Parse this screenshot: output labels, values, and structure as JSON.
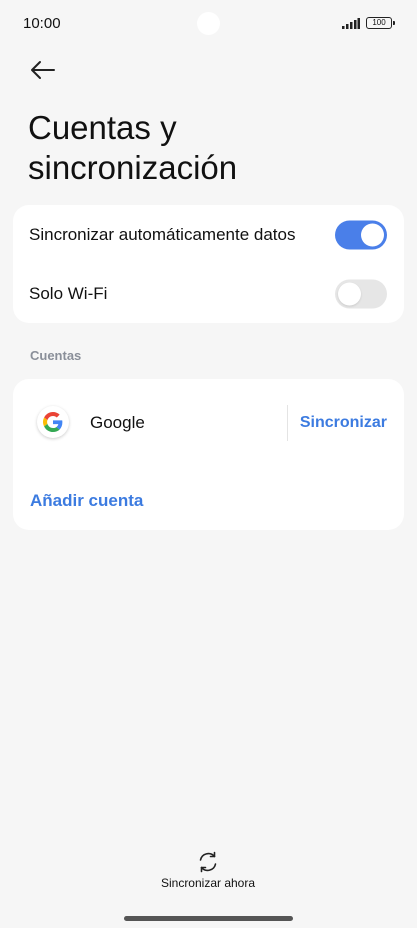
{
  "status_bar": {
    "time": "10:00",
    "battery": "100"
  },
  "header": {
    "title": "Cuentas y sincronización"
  },
  "settings": [
    {
      "label": "Sincronizar automáticamente datos",
      "enabled": true
    },
    {
      "label": "Solo Wi-Fi",
      "enabled": false
    }
  ],
  "accounts_section": {
    "heading": "Cuentas",
    "accounts": [
      {
        "name": "Google",
        "icon": "google-icon",
        "action_label": "Sincronizar"
      }
    ],
    "add_label": "Añadir cuenta"
  },
  "footer": {
    "sync_now_label": "Sincronizar ahora",
    "icon": "sync-icon"
  },
  "colors": {
    "accent": "#4a7fe9",
    "link": "#3c7be0",
    "background": "#f6f6f6"
  }
}
